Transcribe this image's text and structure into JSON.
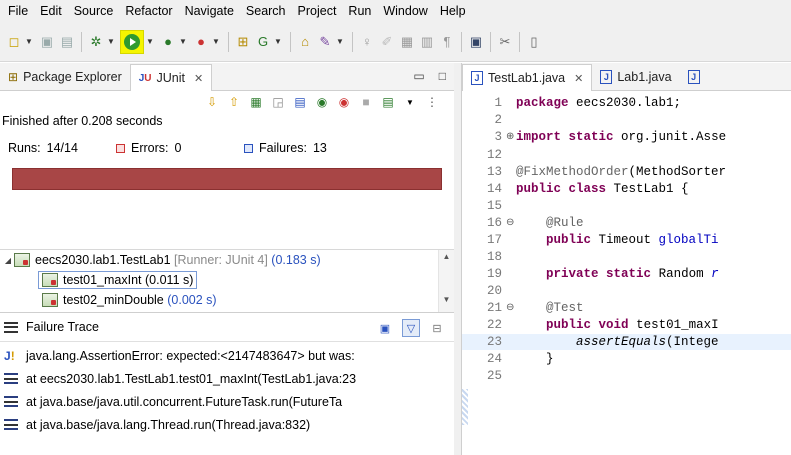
{
  "menu": [
    "File",
    "Edit",
    "Source",
    "Refactor",
    "Navigate",
    "Search",
    "Project",
    "Run",
    "Window",
    "Help"
  ],
  "left_tabs": [
    {
      "label": "Package Explorer",
      "icon": "package-explorer-icon"
    },
    {
      "label": "JUnit",
      "icon": "junit-icon",
      "active": true
    }
  ],
  "junit": {
    "finished": "Finished after 0.208 seconds",
    "runs_label": "Runs:",
    "runs_value": "14/14",
    "errors_label": "Errors:",
    "errors_value": "0",
    "failures_label": "Failures:",
    "failures_value": "13",
    "progress_color": "#a84646"
  },
  "tree": [
    {
      "name": "eecs2030.lab1.TestLab1",
      "runner": "[Runner: JUnit 4]",
      "time": "(0.183 s)"
    },
    {
      "name": "test01_maxInt",
      "time": "(0.011 s)"
    },
    {
      "name": "test02_minDouble",
      "time": "(0.002 s)"
    }
  ],
  "failure_trace": {
    "title": "Failure Trace",
    "lines": [
      "java.lang.AssertionError: expected:<2147483647> but was:",
      "at eecs2030.lab1.TestLab1.test01_maxInt(TestLab1.java:23",
      "at java.base/java.util.concurrent.FutureTask.run(FutureTa",
      "at java.base/java.lang.Thread.run(Thread.java:832)"
    ]
  },
  "editor_tabs": [
    {
      "label": "TestLab1.java",
      "active": true
    },
    {
      "label": "Lab1.java"
    }
  ],
  "code": [
    {
      "ln": "1",
      "text": "package eecs2030.lab1;"
    },
    {
      "ln": "2",
      "text": ""
    },
    {
      "ln": "3",
      "text": "import static org.junit.Asse"
    },
    {
      "ln": "12",
      "text": ""
    },
    {
      "ln": "13",
      "text": "@FixMethodOrder(MethodSorter"
    },
    {
      "ln": "14",
      "text": "public class TestLab1 {"
    },
    {
      "ln": "15",
      "text": ""
    },
    {
      "ln": "16",
      "text": "    @Rule"
    },
    {
      "ln": "17",
      "text": "    public Timeout globalTi"
    },
    {
      "ln": "18",
      "text": ""
    },
    {
      "ln": "19",
      "text": "    private static Random r"
    },
    {
      "ln": "20",
      "text": ""
    },
    {
      "ln": "21",
      "text": "    @Test"
    },
    {
      "ln": "22",
      "text": "    public void test01_maxI"
    },
    {
      "ln": "23",
      "text": "        assertEquals(Intege"
    },
    {
      "ln": "24",
      "text": "    }"
    },
    {
      "ln": "25",
      "text": ""
    }
  ]
}
